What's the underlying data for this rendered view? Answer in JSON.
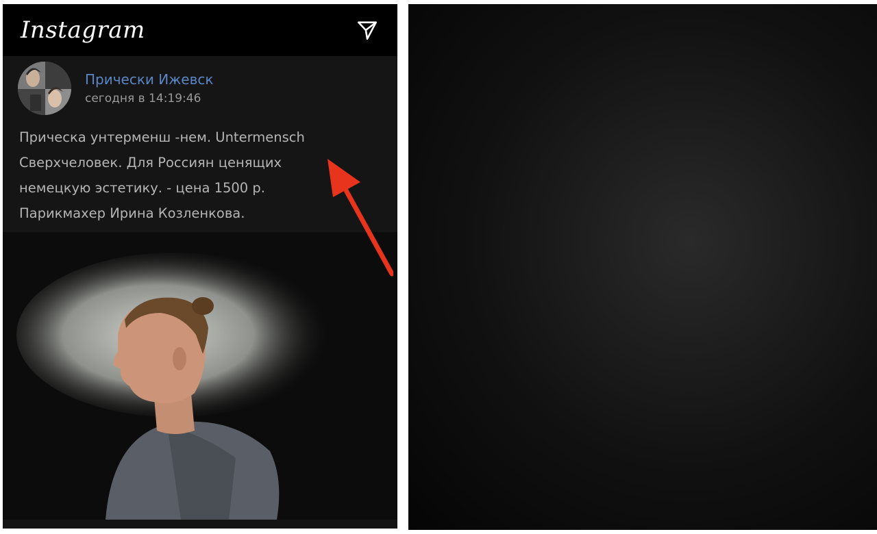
{
  "app": {
    "name": "Instagram"
  },
  "post": {
    "author": "Прически Ижевск",
    "timestamp": "сегодня в 14:19:46",
    "text_lines": [
      "Прическа унтерменш -нем. Untermensch",
      "Сверхчеловек. Для Россиян ценящих",
      "немецкую эстетику. - цена 1500 р.",
      "Парикмахер Ирина Козленкова."
    ]
  },
  "icons": {
    "share": "send-icon",
    "annotation": "arrow-icon"
  },
  "colors": {
    "background": "#141414",
    "header": "#000000",
    "author_link": "#5b86c6",
    "text": "#b5b5b5",
    "arrow": "#e8341c"
  }
}
